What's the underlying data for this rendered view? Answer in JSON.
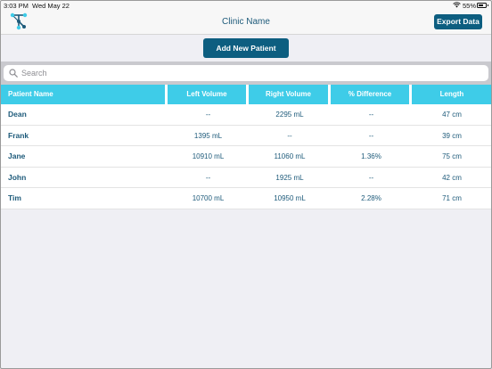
{
  "status_bar": {
    "time": "3:03 PM",
    "date": "Wed May 22",
    "battery_pct": "55%",
    "icons": [
      "wifi-icon",
      "battery-icon"
    ]
  },
  "nav": {
    "title": "Clinic Name",
    "export_label": "Export Data",
    "logo_icon": "clinic-logo-icon"
  },
  "actions": {
    "add_patient_label": "Add New Patient"
  },
  "search": {
    "placeholder": "Search",
    "value": ""
  },
  "table": {
    "headers": [
      "Patient Name",
      "Left Volume",
      "Right Volume",
      "% Difference",
      "Length"
    ],
    "rows": [
      [
        "Dean",
        "--",
        "2295 mL",
        "--",
        "47 cm"
      ],
      [
        "Frank",
        "1395 mL",
        "--",
        "--",
        "39 cm"
      ],
      [
        "Jane",
        "10910 mL",
        "11060 mL",
        "1.36%",
        "75 cm"
      ],
      [
        "John",
        "--",
        "1925 mL",
        "--",
        "42 cm"
      ],
      [
        "Tim",
        "10700 mL",
        "10950 mL",
        "2.28%",
        "71 cm"
      ]
    ]
  },
  "colors": {
    "accent": "#0d5e80",
    "header_bg": "#3ecce8",
    "text": "#1d5a7a"
  }
}
